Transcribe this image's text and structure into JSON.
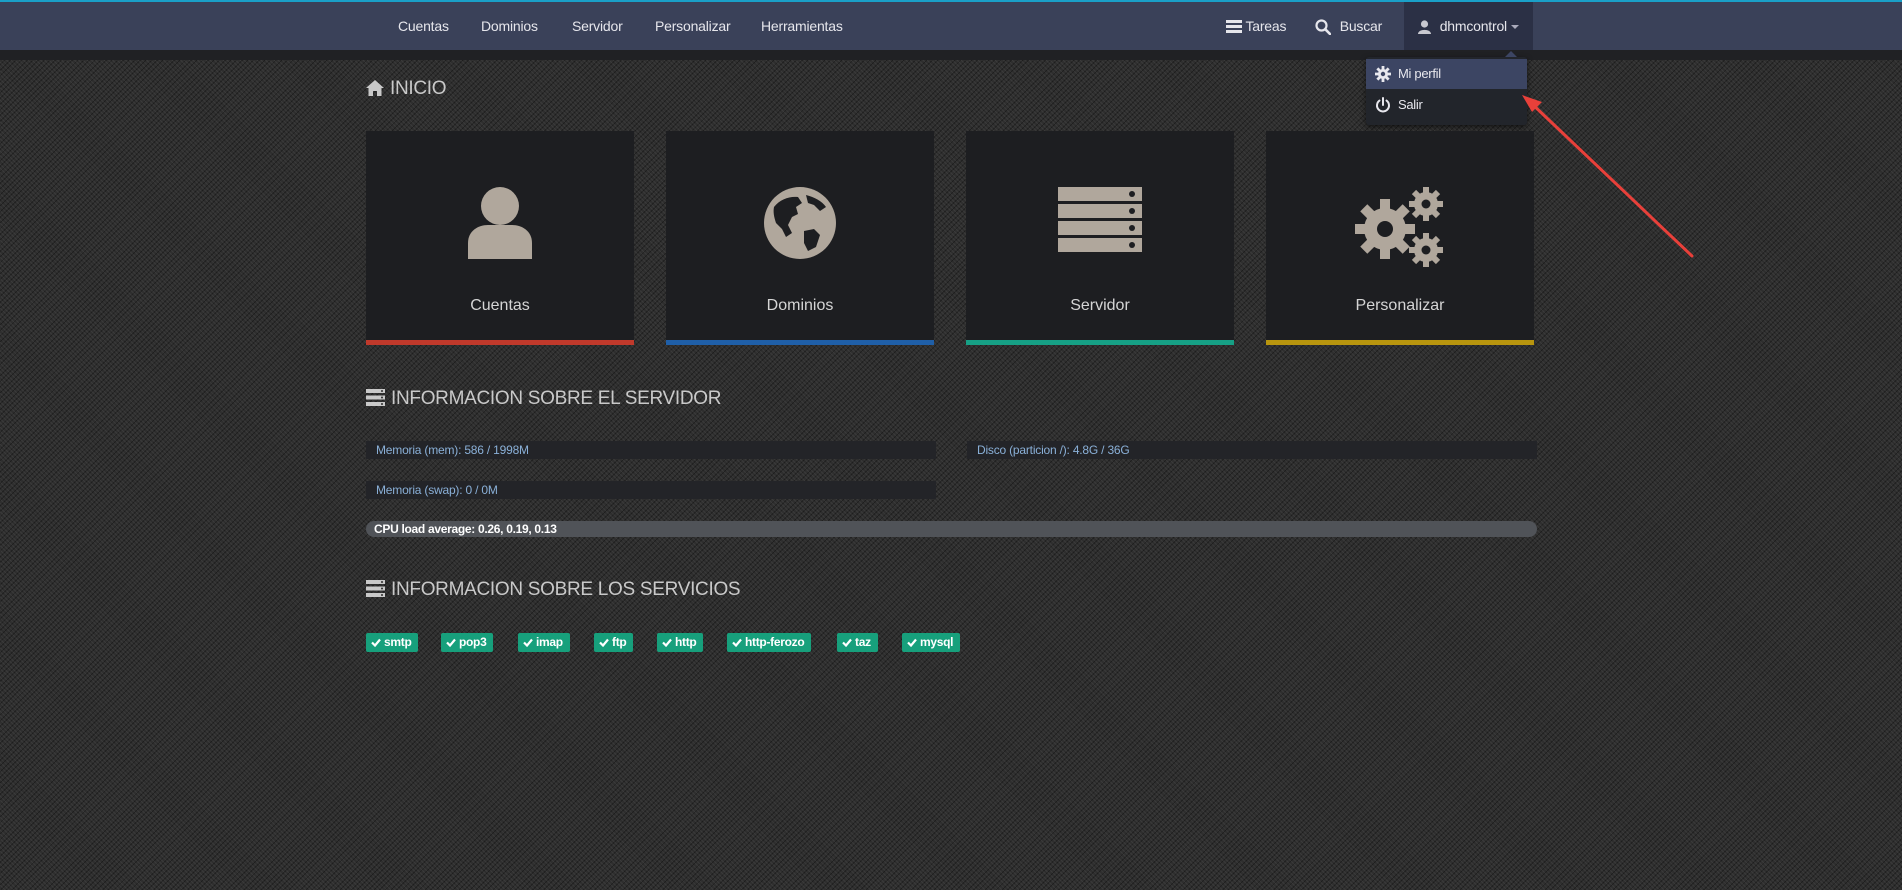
{
  "nav": {
    "items": [
      "Cuentas",
      "Dominios",
      "Servidor",
      "Personalizar",
      "Herramientas"
    ],
    "tasks_label": "Tareas",
    "search_label": "Buscar",
    "user_label": "dhmcontrol"
  },
  "dropdown": {
    "items": [
      {
        "label": "Mi perfil",
        "icon": "gear-icon"
      },
      {
        "label": "Salir",
        "icon": "power-icon"
      }
    ]
  },
  "home": {
    "title": "INICIO",
    "tiles": [
      {
        "label": "Cuentas",
        "icon": "user-icon",
        "color": "#c0392b"
      },
      {
        "label": "Dominios",
        "icon": "globe-icon",
        "color": "#1f5fa8"
      },
      {
        "label": "Servidor",
        "icon": "server-icon",
        "color": "#16a085"
      },
      {
        "label": "Personalizar",
        "icon": "gears-icon",
        "color": "#b8950e"
      }
    ]
  },
  "server_info": {
    "title": "INFORMACION SOBRE EL SERVIDOR",
    "memory": "Memoria (mem): 586 / 1998M",
    "disk": "Disco (particion /): 4.8G / 36G",
    "swap": "Memoria (swap): 0 / 0M",
    "cpu": "CPU load average: 0.26, 0.19, 0.13"
  },
  "services": {
    "title": "INFORMACION SOBRE LOS SERVICIOS",
    "items": [
      "smtp",
      "pop3",
      "imap",
      "ftp",
      "http",
      "http-ferozo",
      "taz",
      "mysql"
    ],
    "color": "#17a07c"
  },
  "accent": {
    "topline": "#1aa0c8",
    "navbar": "#3a4159",
    "annotation_arrow": "#e8403a"
  }
}
